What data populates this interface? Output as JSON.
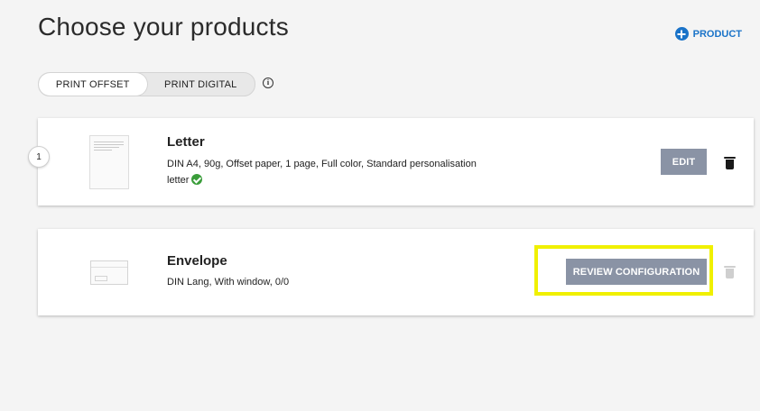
{
  "header": {
    "title": "Choose your products",
    "add_product_label": "PRODUCT"
  },
  "print_toggle": {
    "options": [
      "PRINT OFFSET",
      "PRINT DIGITAL"
    ],
    "selected": "PRINT OFFSET"
  },
  "products": [
    {
      "step": "1",
      "name": "Letter",
      "description_line1": "DIN A4, 90g, Offset paper, 1 page, Full color, Standard personalisation",
      "description_line2": "letter",
      "status": "complete",
      "action_label": "EDIT"
    },
    {
      "name": "Envelope",
      "description_line1": "DIN Lang, With window, 0/0",
      "action_label": "REVIEW CONFIGURATION",
      "highlighted": true
    }
  ],
  "colors": {
    "accent": "#1a73c8",
    "button": "#8a93a5",
    "highlight": "#f0f000",
    "success": "#3a9d3a"
  }
}
